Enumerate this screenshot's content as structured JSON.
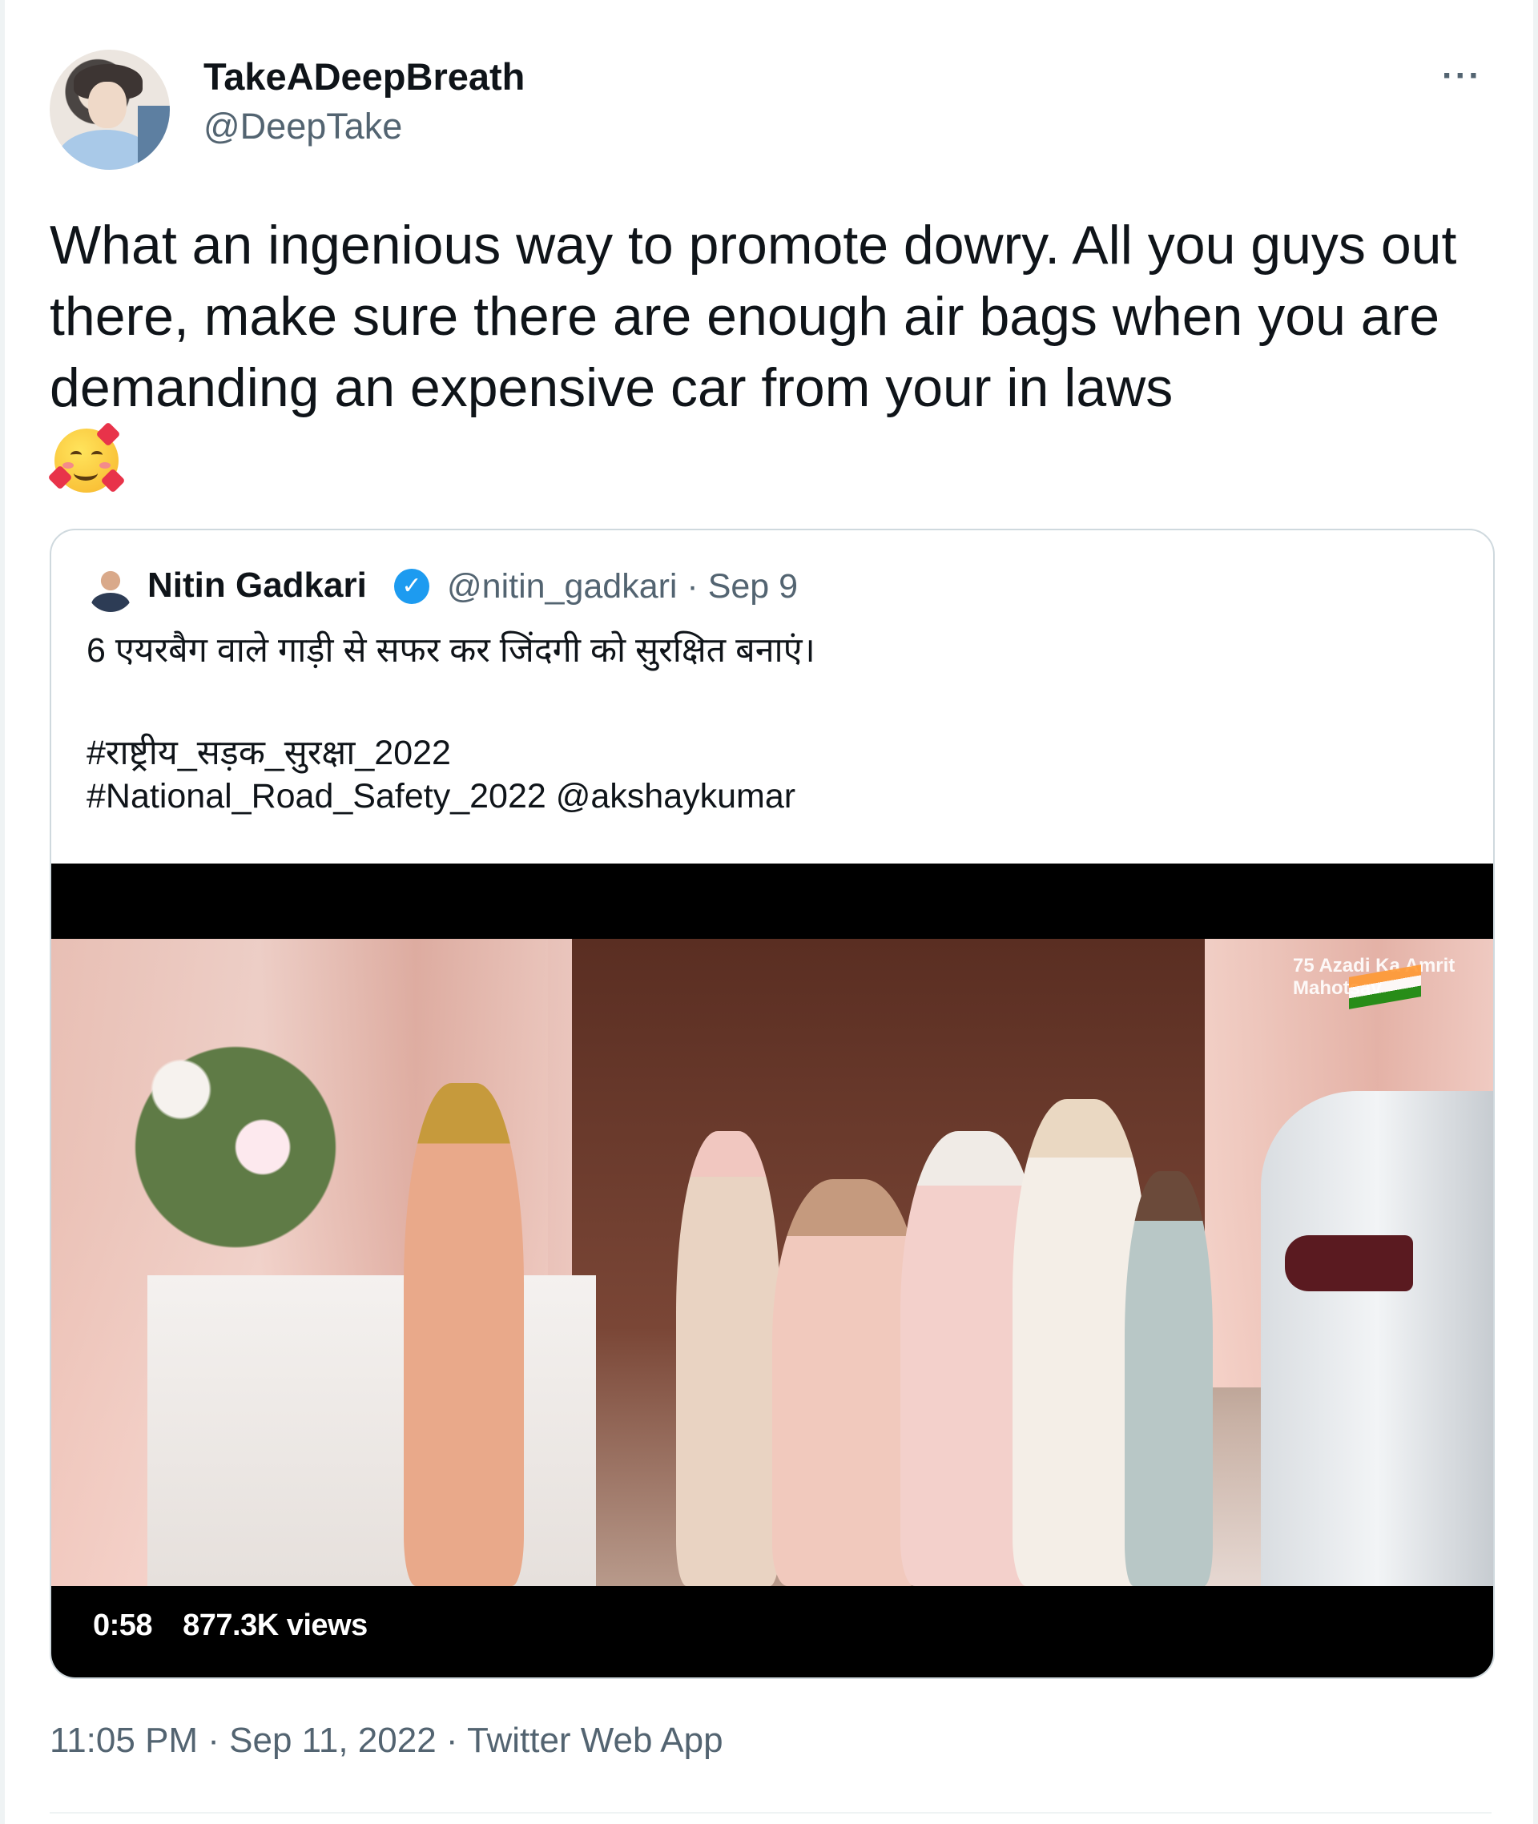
{
  "author": {
    "name": "TakeADeepBreath",
    "handle": "@DeepTake",
    "avatar_icon": "profile-photo"
  },
  "more_label": "···",
  "tweet": {
    "text": "What an ingenious way to promote dowry. All you guys out there, make sure there are enough air bags when you are demanding an expensive car from your in laws",
    "emoji_icon": "smiling-face-with-hearts-emoji"
  },
  "quoted": {
    "name": "Nitin Gadkari",
    "verified_icon": "verified-badge-icon",
    "meta": "@nitin_gadkari · Sep 9",
    "line1": "6 एयरबैग वाले गाड़ी से सफर कर जिंदगी को सुरक्षित बनाएं।",
    "line2": "#राष्ट्रीय_सड़क_सुरक्षा_2022",
    "line3": "#National_Road_Safety_2022 @akshaykumar",
    "video": {
      "duration": "0:58",
      "views": "877.3K views"
    }
  },
  "timestamp": "11:05 PM · Sep 11, 2022 · Twitter Web App",
  "colors": {
    "text": "#0f1419",
    "muted": "#536471",
    "verified": "#1d9bf0",
    "border": "#cfd9de"
  }
}
